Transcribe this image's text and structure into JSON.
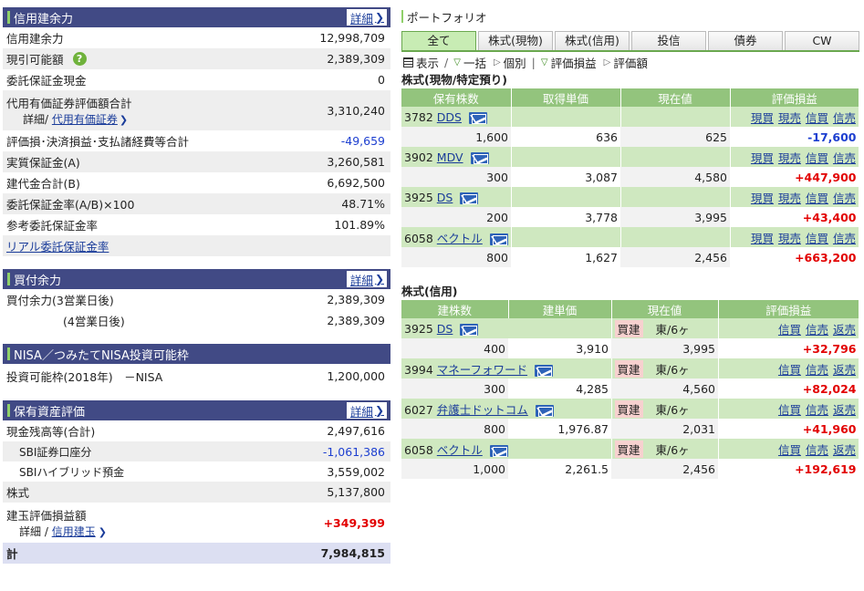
{
  "margin_power": {
    "title": "信用建余力",
    "detail": "詳細",
    "rows": [
      {
        "label": "信用建余力",
        "value": "12,998,709"
      },
      {
        "label": "現引可能額",
        "value": "2,389,309"
      },
      {
        "label": "委託保証金現金",
        "value": "0"
      },
      {
        "label": "代用有価証券評価額合計",
        "value": "3,310,240",
        "sub_prefix": "詳細/ ",
        "sub_link": "代用有価証券"
      },
      {
        "label": "評価損･決済損益･支払諸経費等合計",
        "value": "-49,659"
      },
      {
        "label": "実質保証金(A)",
        "value": "3,260,581"
      },
      {
        "label": "建代金合計(B)",
        "value": "6,692,500"
      },
      {
        "label": "委託保証金率(A/B)×100",
        "value": "48.71%"
      },
      {
        "label": "参考委託保証金率",
        "value": "101.89%"
      }
    ],
    "link": "リアル委託保証金率"
  },
  "buying_power": {
    "title": "買付余力",
    "detail": "詳細",
    "rows": [
      {
        "label": "買付余力(3営業日後)",
        "value": "2,389,309"
      },
      {
        "label": "(4営業日後)",
        "value": "2,389,309"
      }
    ]
  },
  "nisa": {
    "title": "NISA／つみたてNISA投資可能枠",
    "label": "投資可能枠(2018年)　－NISA",
    "value": "1,200,000"
  },
  "assets": {
    "title": "保有資産評価",
    "detail": "詳細",
    "rows": [
      {
        "label": "現金残高等(合計)",
        "value": "2,497,616"
      },
      {
        "label": "SBI証券口座分",
        "value": "-1,061,386"
      },
      {
        "label": "SBIハイブリッド預金",
        "value": "3,559,002"
      },
      {
        "label": "株式",
        "value": "5,137,800"
      },
      {
        "label": "建玉評価損益額",
        "value": "+349,399",
        "sub_prefix": "詳細 / ",
        "sub_link": "信用建玉"
      }
    ],
    "total_label": "計",
    "total_value": "7,984,815"
  },
  "portfolio": {
    "title": "ポートフォリオ",
    "tabs": [
      "全て",
      "株式(現物)",
      "株式(信用)",
      "投信",
      "債券",
      "CW"
    ],
    "view": {
      "display": "表示",
      "lump": "一括",
      "individual": "個別",
      "pl": "評価損益",
      "value": "評価額"
    },
    "spot": {
      "title": "株式(現物/特定預り)",
      "headers": [
        "保有株数",
        "取得単価",
        "現在値",
        "評価損益"
      ],
      "actions": [
        "現買",
        "現売",
        "信買",
        "信売"
      ],
      "rows": [
        {
          "code": "3782",
          "name": "DDS",
          "qty": "1,600",
          "cost": "636",
          "price": "625",
          "pl": "-17,600"
        },
        {
          "code": "3902",
          "name": "MDV",
          "qty": "300",
          "cost": "3,087",
          "price": "4,580",
          "pl": "+447,900"
        },
        {
          "code": "3925",
          "name": "DS",
          "qty": "200",
          "cost": "3,778",
          "price": "3,995",
          "pl": "+43,400"
        },
        {
          "code": "6058",
          "name": "ベクトル",
          "qty": "800",
          "cost": "1,627",
          "price": "2,456",
          "pl": "+663,200"
        }
      ]
    },
    "margin": {
      "title": "株式(信用)",
      "headers": [
        "建株数",
        "建単価",
        "現在値",
        "評価損益"
      ],
      "actions": [
        "信買",
        "信売",
        "返売"
      ],
      "rows": [
        {
          "code": "3925",
          "name": "DS",
          "side": "買建",
          "market": "東/6ヶ",
          "qty": "400",
          "cost": "3,910",
          "price": "3,995",
          "pl": "+32,796"
        },
        {
          "code": "3994",
          "name": "マネーフォワード",
          "side": "買建",
          "market": "東/6ヶ",
          "qty": "300",
          "cost": "4,285",
          "price": "4,560",
          "pl": "+82,024"
        },
        {
          "code": "6027",
          "name": "弁護士ドットコム",
          "side": "買建",
          "market": "東/6ヶ",
          "qty": "800",
          "cost": "1,976.87",
          "price": "2,031",
          "pl": "+41,960"
        },
        {
          "code": "6058",
          "name": "ベクトル",
          "side": "買建",
          "market": "東/6ヶ",
          "qty": "1,000",
          "cost": "2,261.5",
          "price": "2,456",
          "pl": "+192,619"
        }
      ]
    }
  }
}
